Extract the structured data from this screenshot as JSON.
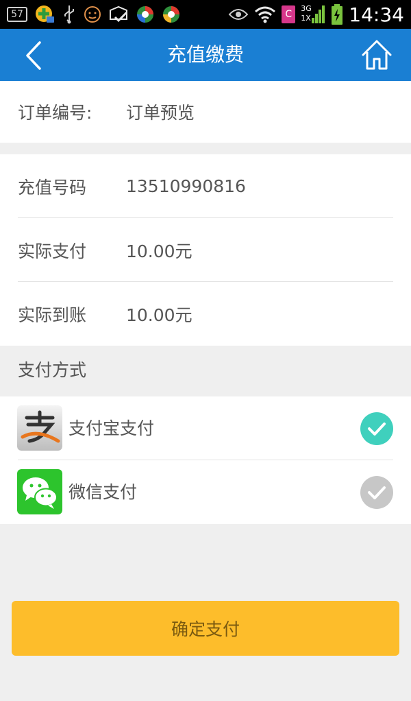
{
  "status_bar": {
    "badge": "57",
    "c_icon": "C",
    "network": "3G",
    "network2": "1X",
    "time": "14:34"
  },
  "header": {
    "title": "充值缴费",
    "back_icon": "chevron-left-icon",
    "home_icon": "home-icon",
    "color": "#1a7fd3"
  },
  "order": {
    "label": "订单编号:",
    "value": "订单预览"
  },
  "details": [
    {
      "label": "充值号码",
      "value": "13510990816"
    },
    {
      "label": "实际支付",
      "value": "10.00元"
    },
    {
      "label": "实际到账",
      "value": "10.00元"
    }
  ],
  "payment": {
    "section_label": "支付方式",
    "methods": [
      {
        "name": "支付宝支付",
        "icon": "alipay-icon",
        "selected": true,
        "check_color": "#3fd0bd"
      },
      {
        "name": "微信支付",
        "icon": "wechat-icon",
        "selected": false,
        "check_color": "#c7c7c7"
      }
    ]
  },
  "confirm": {
    "label": "确定支付",
    "color": "#fdbd2b"
  }
}
